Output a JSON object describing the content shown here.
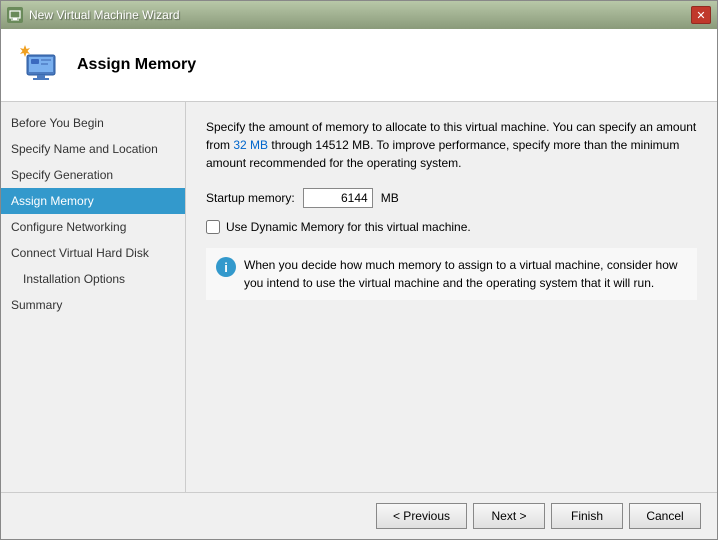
{
  "window": {
    "title": "New Virtual Machine Wizard",
    "close_button_label": "✕"
  },
  "header": {
    "title": "Assign Memory",
    "icon_alt": "virtual machine icon"
  },
  "sidebar": {
    "items": [
      {
        "id": "before-you-begin",
        "label": "Before You Begin",
        "active": false,
        "sub": false
      },
      {
        "id": "specify-name-location",
        "label": "Specify Name and Location",
        "active": false,
        "sub": false
      },
      {
        "id": "specify-generation",
        "label": "Specify Generation",
        "active": false,
        "sub": false
      },
      {
        "id": "assign-memory",
        "label": "Assign Memory",
        "active": true,
        "sub": false
      },
      {
        "id": "configure-networking",
        "label": "Configure Networking",
        "active": false,
        "sub": false
      },
      {
        "id": "connect-virtual-hard-disk",
        "label": "Connect Virtual Hard Disk",
        "active": false,
        "sub": false
      },
      {
        "id": "installation-options",
        "label": "Installation Options",
        "active": false,
        "sub": true
      },
      {
        "id": "summary",
        "label": "Summary",
        "active": false,
        "sub": false
      }
    ]
  },
  "main": {
    "description_part1": "Specify the amount of memory to allocate to this virtual machine. You can specify an amount from ",
    "description_link1": "32 MB",
    "description_part2": " through 14512 MB. To improve performance, specify more than the minimum amount recommended for the operating system.",
    "startup_label": "Startup memory:",
    "startup_value": "6144",
    "startup_unit": "MB",
    "dynamic_memory_label": "Use Dynamic Memory for this virtual machine.",
    "info_text": "When you decide how much memory to assign to a virtual machine, consider how you intend to use the virtual machine and the operating system that it will run."
  },
  "footer": {
    "previous_label": "< Previous",
    "next_label": "Next >",
    "finish_label": "Finish",
    "cancel_label": "Cancel"
  }
}
